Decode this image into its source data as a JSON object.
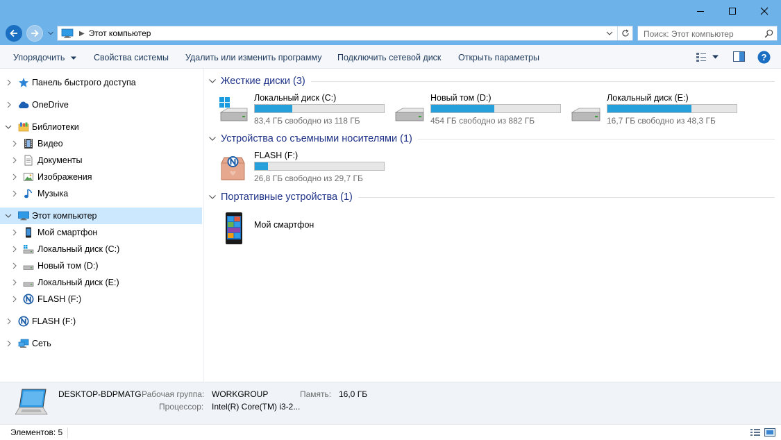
{
  "window": {
    "minimize_icon": "minimize-icon",
    "maximize_icon": "maximize-icon",
    "close_icon": "close-icon"
  },
  "address": {
    "path": "Этот компьютер",
    "search_placeholder": "Поиск: Этот компьютер"
  },
  "toolbar": {
    "organize": "Упорядочить",
    "system_properties": "Свойства системы",
    "uninstall": "Удалить или изменить программу",
    "map_drive": "Подключить сетевой диск",
    "open_settings": "Открыть параметры"
  },
  "nav": {
    "quick_access": "Панель быстрого доступа",
    "onedrive": "OneDrive",
    "libraries": "Библиотеки",
    "video": "Видео",
    "documents": "Документы",
    "images": "Изображения",
    "music": "Музыка",
    "this_pc": "Этот компьютер",
    "smartphone": "Мой смартфон",
    "disk_c": "Локальный диск (C:)",
    "disk_d": "Новый том (D:)",
    "disk_e": "Локальный диск (E:)",
    "flash_child": "FLASH (F:)",
    "flash_root": "FLASH (F:)",
    "network": "Сеть"
  },
  "groups": {
    "hard_drives": "Жесткие диски (3)",
    "removable": "Устройства со съемными носителями (1)",
    "portable": "Портативные устройства (1)"
  },
  "drives": [
    {
      "name": "Локальный диск (C:)",
      "free": "83,4 ГБ свободно из 118 ГБ",
      "used_fraction": 0.29
    },
    {
      "name": "Новый том (D:)",
      "free": "454 ГБ свободно из 882 ГБ",
      "used_fraction": 0.49
    },
    {
      "name": "Локальный диск (E:)",
      "free": "16,7 ГБ свободно из 48,3 ГБ",
      "used_fraction": 0.65
    },
    {
      "name": "FLASH (F:)",
      "free": "26,8 ГБ свободно из 29,7 ГБ",
      "used_fraction": 0.1
    }
  ],
  "portable_device": "Мой смартфон",
  "details": {
    "computer_name": "DESKTOP-BDPMATG",
    "workgroup_label": "Рабочая группа:",
    "workgroup_value": "WORKGROUP",
    "memory_label": "Память:",
    "memory_value": "16,0 ГБ",
    "cpu_label": "Процессор:",
    "cpu_value": "Intel(R) Core(TM) i3-2..."
  },
  "status": {
    "items": "Элементов: 5"
  },
  "colors": {
    "titlebar": "#6db2e8",
    "progress": "#26a0da",
    "selection": "#cce8ff",
    "group_title": "#1e3287"
  }
}
